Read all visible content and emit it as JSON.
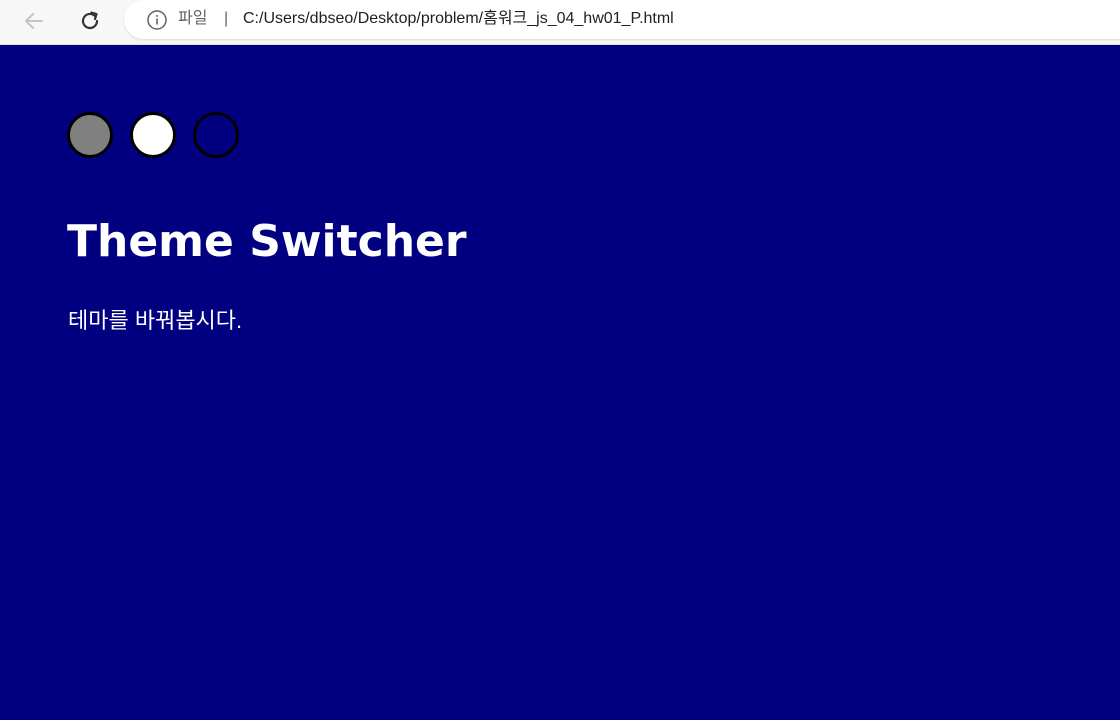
{
  "browser": {
    "scheme_label": "파일",
    "separator": "|",
    "url": "C:/Users/dbseo/Desktop/problem/홈워크_js_04_hw01_P.html",
    "icons": {
      "back": "arrow-left-icon",
      "reload": "reload-icon",
      "info": "info-icon"
    }
  },
  "page": {
    "background_color": "#000080",
    "text_color": "#ffffff",
    "theme_buttons": [
      {
        "color": "#808080",
        "name": "gray"
      },
      {
        "color": "#ffffff",
        "name": "white"
      },
      {
        "color": "#000080",
        "name": "navy"
      }
    ],
    "title": "Theme Switcher",
    "description": "테마를 바꿔봅시다."
  }
}
